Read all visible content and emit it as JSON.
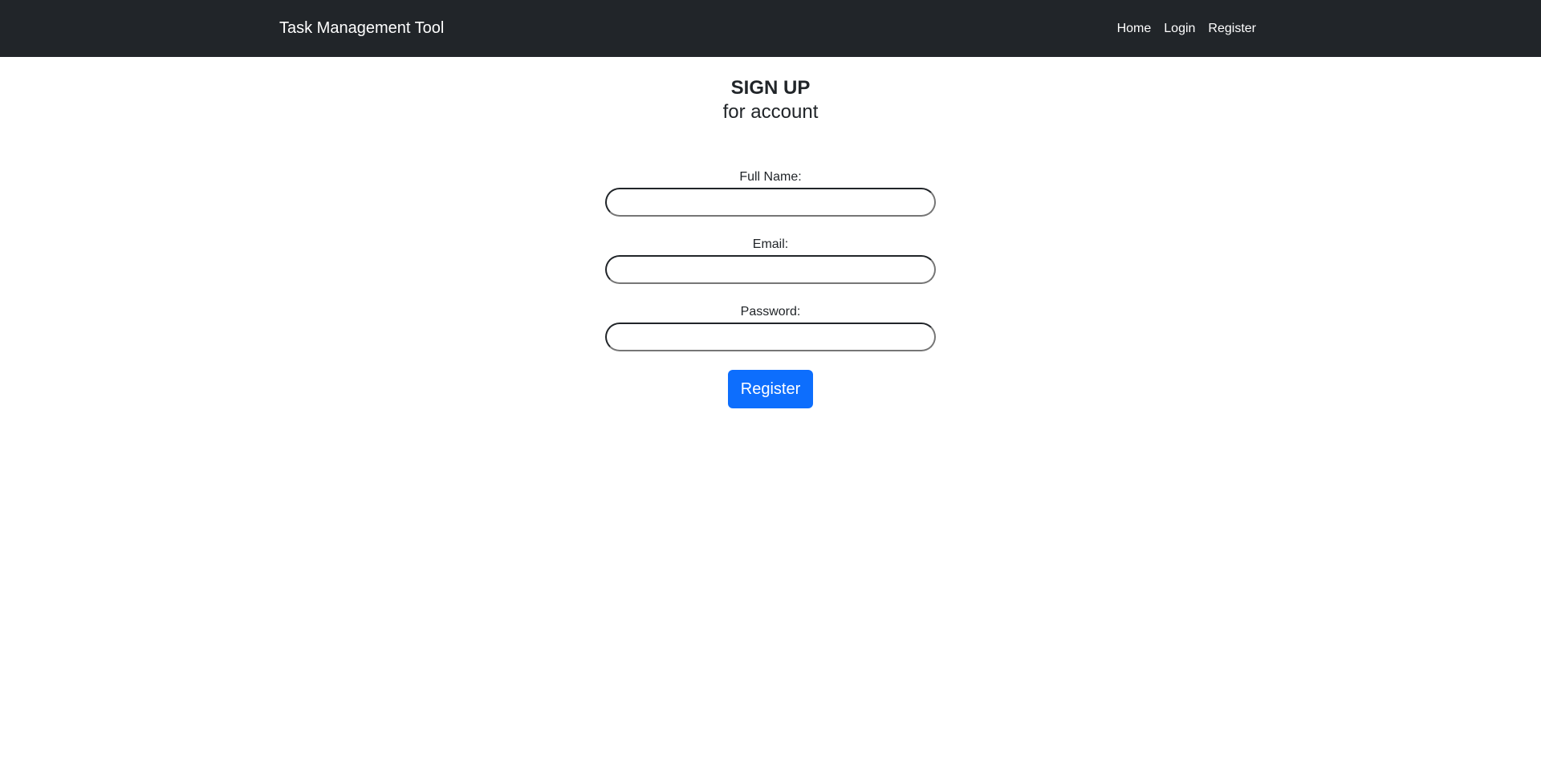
{
  "navbar": {
    "brand": "Task Management Tool",
    "links": [
      {
        "label": "Home"
      },
      {
        "label": "Login"
      },
      {
        "label": "Register"
      }
    ]
  },
  "heading": {
    "title": "SIGN UP",
    "subtitle": "for account"
  },
  "form": {
    "full_name": {
      "label": "Full Name:",
      "value": ""
    },
    "email": {
      "label": "Email:",
      "value": ""
    },
    "password": {
      "label": "Password:",
      "value": ""
    },
    "submit_label": "Register"
  },
  "colors": {
    "navbar_bg": "#212529",
    "primary": "#0d6efd"
  }
}
